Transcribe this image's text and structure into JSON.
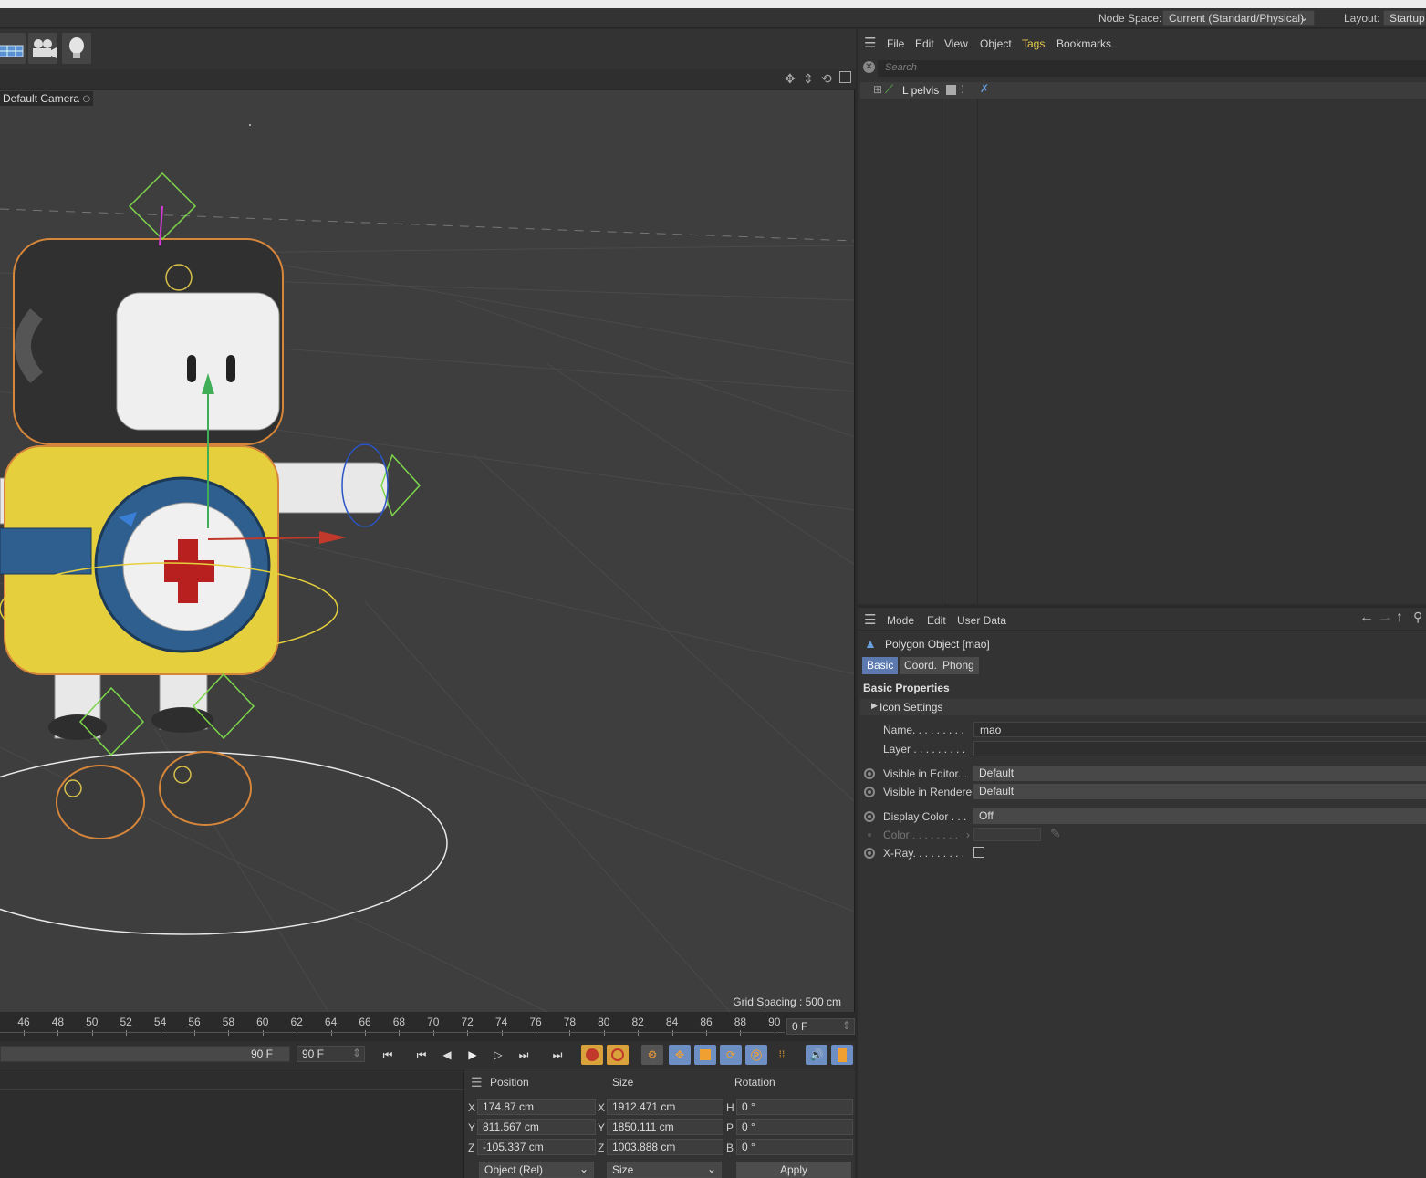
{
  "topbar": {
    "node_space_label": "Node Space:",
    "node_space_value": "Current (Standard/Physical)",
    "layout_label": "Layout:",
    "layout_value": "Startup"
  },
  "viewport": {
    "camera_label": "Default Camera",
    "grid_spacing": "Grid Spacing : 500 cm"
  },
  "timeline": {
    "ticks": [
      "46",
      "48",
      "50",
      "52",
      "54",
      "56",
      "58",
      "60",
      "62",
      "64",
      "66",
      "68",
      "70",
      "72",
      "74",
      "76",
      "78",
      "80",
      "82",
      "84",
      "86",
      "88",
      "90"
    ],
    "current_frame": "0 F",
    "end_frame_slider": "90 F",
    "end_frame_field": "90 F"
  },
  "object_manager": {
    "menu": [
      "File",
      "Edit",
      "View",
      "Object",
      "Tags",
      "Bookmarks"
    ],
    "search_placeholder": "Search",
    "objects": [
      {
        "name": "L pelvis"
      }
    ]
  },
  "attribute_manager": {
    "menu": [
      "Mode",
      "Edit",
      "User Data"
    ],
    "object_title": "Polygon Object [mao]",
    "tabs": [
      "Basic",
      "Coord.",
      "Phong"
    ],
    "section_title": "Basic Properties",
    "group": "Icon Settings",
    "name_label": "Name. . . . . . . . .",
    "name_value": "mao",
    "layer_label": "Layer . . . . . . . . .",
    "layer_value": "",
    "visible_editor_label": "Visible in Editor. .",
    "visible_editor_value": "Default",
    "visible_renderer_label": "Visible in Renderer",
    "visible_renderer_value": "Default",
    "display_color_label": "Display Color . . .",
    "display_color_value": "Off",
    "color_label": "Color . . . . . . . .",
    "xray_label": "X-Ray. . . . . . . . ."
  },
  "coordinates": {
    "headers": {
      "position": "Position",
      "size": "Size",
      "rotation": "Rotation"
    },
    "rows": [
      {
        "axis": "X",
        "pos": "174.87 cm",
        "size_axis": "X",
        "size": "1912.471 cm",
        "rot_axis": "H",
        "rot": "0 °"
      },
      {
        "axis": "Y",
        "pos": "811.567 cm",
        "size_axis": "Y",
        "size": "1850.111 cm",
        "rot_axis": "P",
        "rot": "0 °"
      },
      {
        "axis": "Z",
        "pos": "-105.337 cm",
        "size_axis": "Z",
        "size": "1003.888 cm",
        "rot_axis": "B",
        "rot": "0 °"
      }
    ],
    "mode_select": "Object (Rel)",
    "size_select": "Size",
    "apply_label": "Apply"
  },
  "colors": {
    "accent_tab": "#5c7ab0",
    "tags_menu": "#e6c94a",
    "selection_outline": "#d6863a",
    "body_yellow": "#e6cf3c"
  }
}
